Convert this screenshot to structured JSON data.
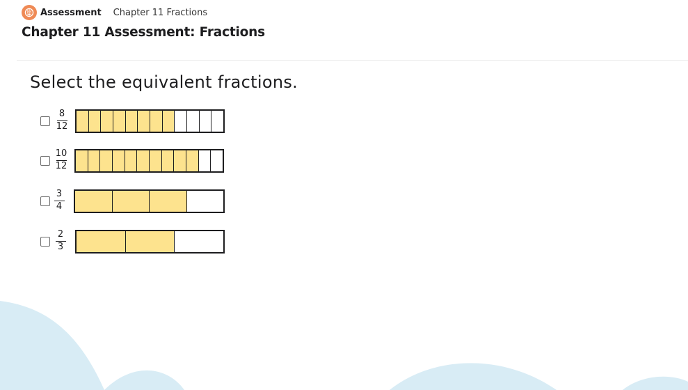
{
  "header": {
    "app_name": "Assessment",
    "breadcrumb": "Chapter 11 Fractions",
    "page_title": "Chapter 11 Assessment: Fractions"
  },
  "question": {
    "prompt": "Select the equivalent fractions.",
    "options": [
      {
        "numerator": "8",
        "denominator": "12",
        "parts": 12,
        "shaded": 8,
        "checked": false
      },
      {
        "numerator": "10",
        "denominator": "12",
        "parts": 12,
        "shaded": 10,
        "checked": false
      },
      {
        "numerator": "3",
        "denominator": "4",
        "parts": 4,
        "shaded": 3,
        "checked": false
      },
      {
        "numerator": "2",
        "denominator": "3",
        "parts": 3,
        "shaded": 2,
        "checked": false
      }
    ]
  },
  "colors": {
    "fill": "#fde38e",
    "outline": "#1d1d1f",
    "logo": "#ef8a55",
    "background_art": "#d8ecf5"
  },
  "icons": {
    "logo": "brain-icon"
  }
}
